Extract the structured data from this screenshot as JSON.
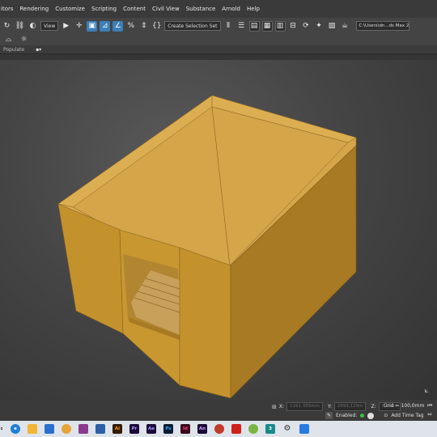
{
  "menu": {
    "items": [
      "itors",
      "Rendering",
      "Customize",
      "Scripting",
      "Content",
      "Civil View",
      "Substance",
      "Arnold",
      "Help"
    ]
  },
  "toolbar": {
    "view_dropdown": "View",
    "selection_set_dropdown": "Create Selection Set",
    "path_field": "C:\\Users\\dn...ds Max 2022"
  },
  "ribbon": {
    "populate_label": "Populate"
  },
  "status": {
    "x_label": "X:",
    "x_value": "1161,355mm",
    "y_label": "Y:",
    "y_value": "2893,129m",
    "z_label": "Z:",
    "z_value": "0,0mm",
    "grid_text": "Grid = 100,0mm",
    "enabled_label": "Enabled:",
    "add_time_tag": "Add Time Tag"
  },
  "taskbar": {
    "app_labels": [
      "Ai",
      "Pr",
      "Ae",
      "Ps",
      "Id",
      "An",
      "3"
    ]
  },
  "colors": {
    "wood_top": "#d4a549",
    "wood_front": "#c4922c",
    "wood_side": "#a77a23",
    "wood_inner": "#b88a30",
    "floor": "#c9a05a",
    "accent_blue": "#3d7fb8"
  }
}
